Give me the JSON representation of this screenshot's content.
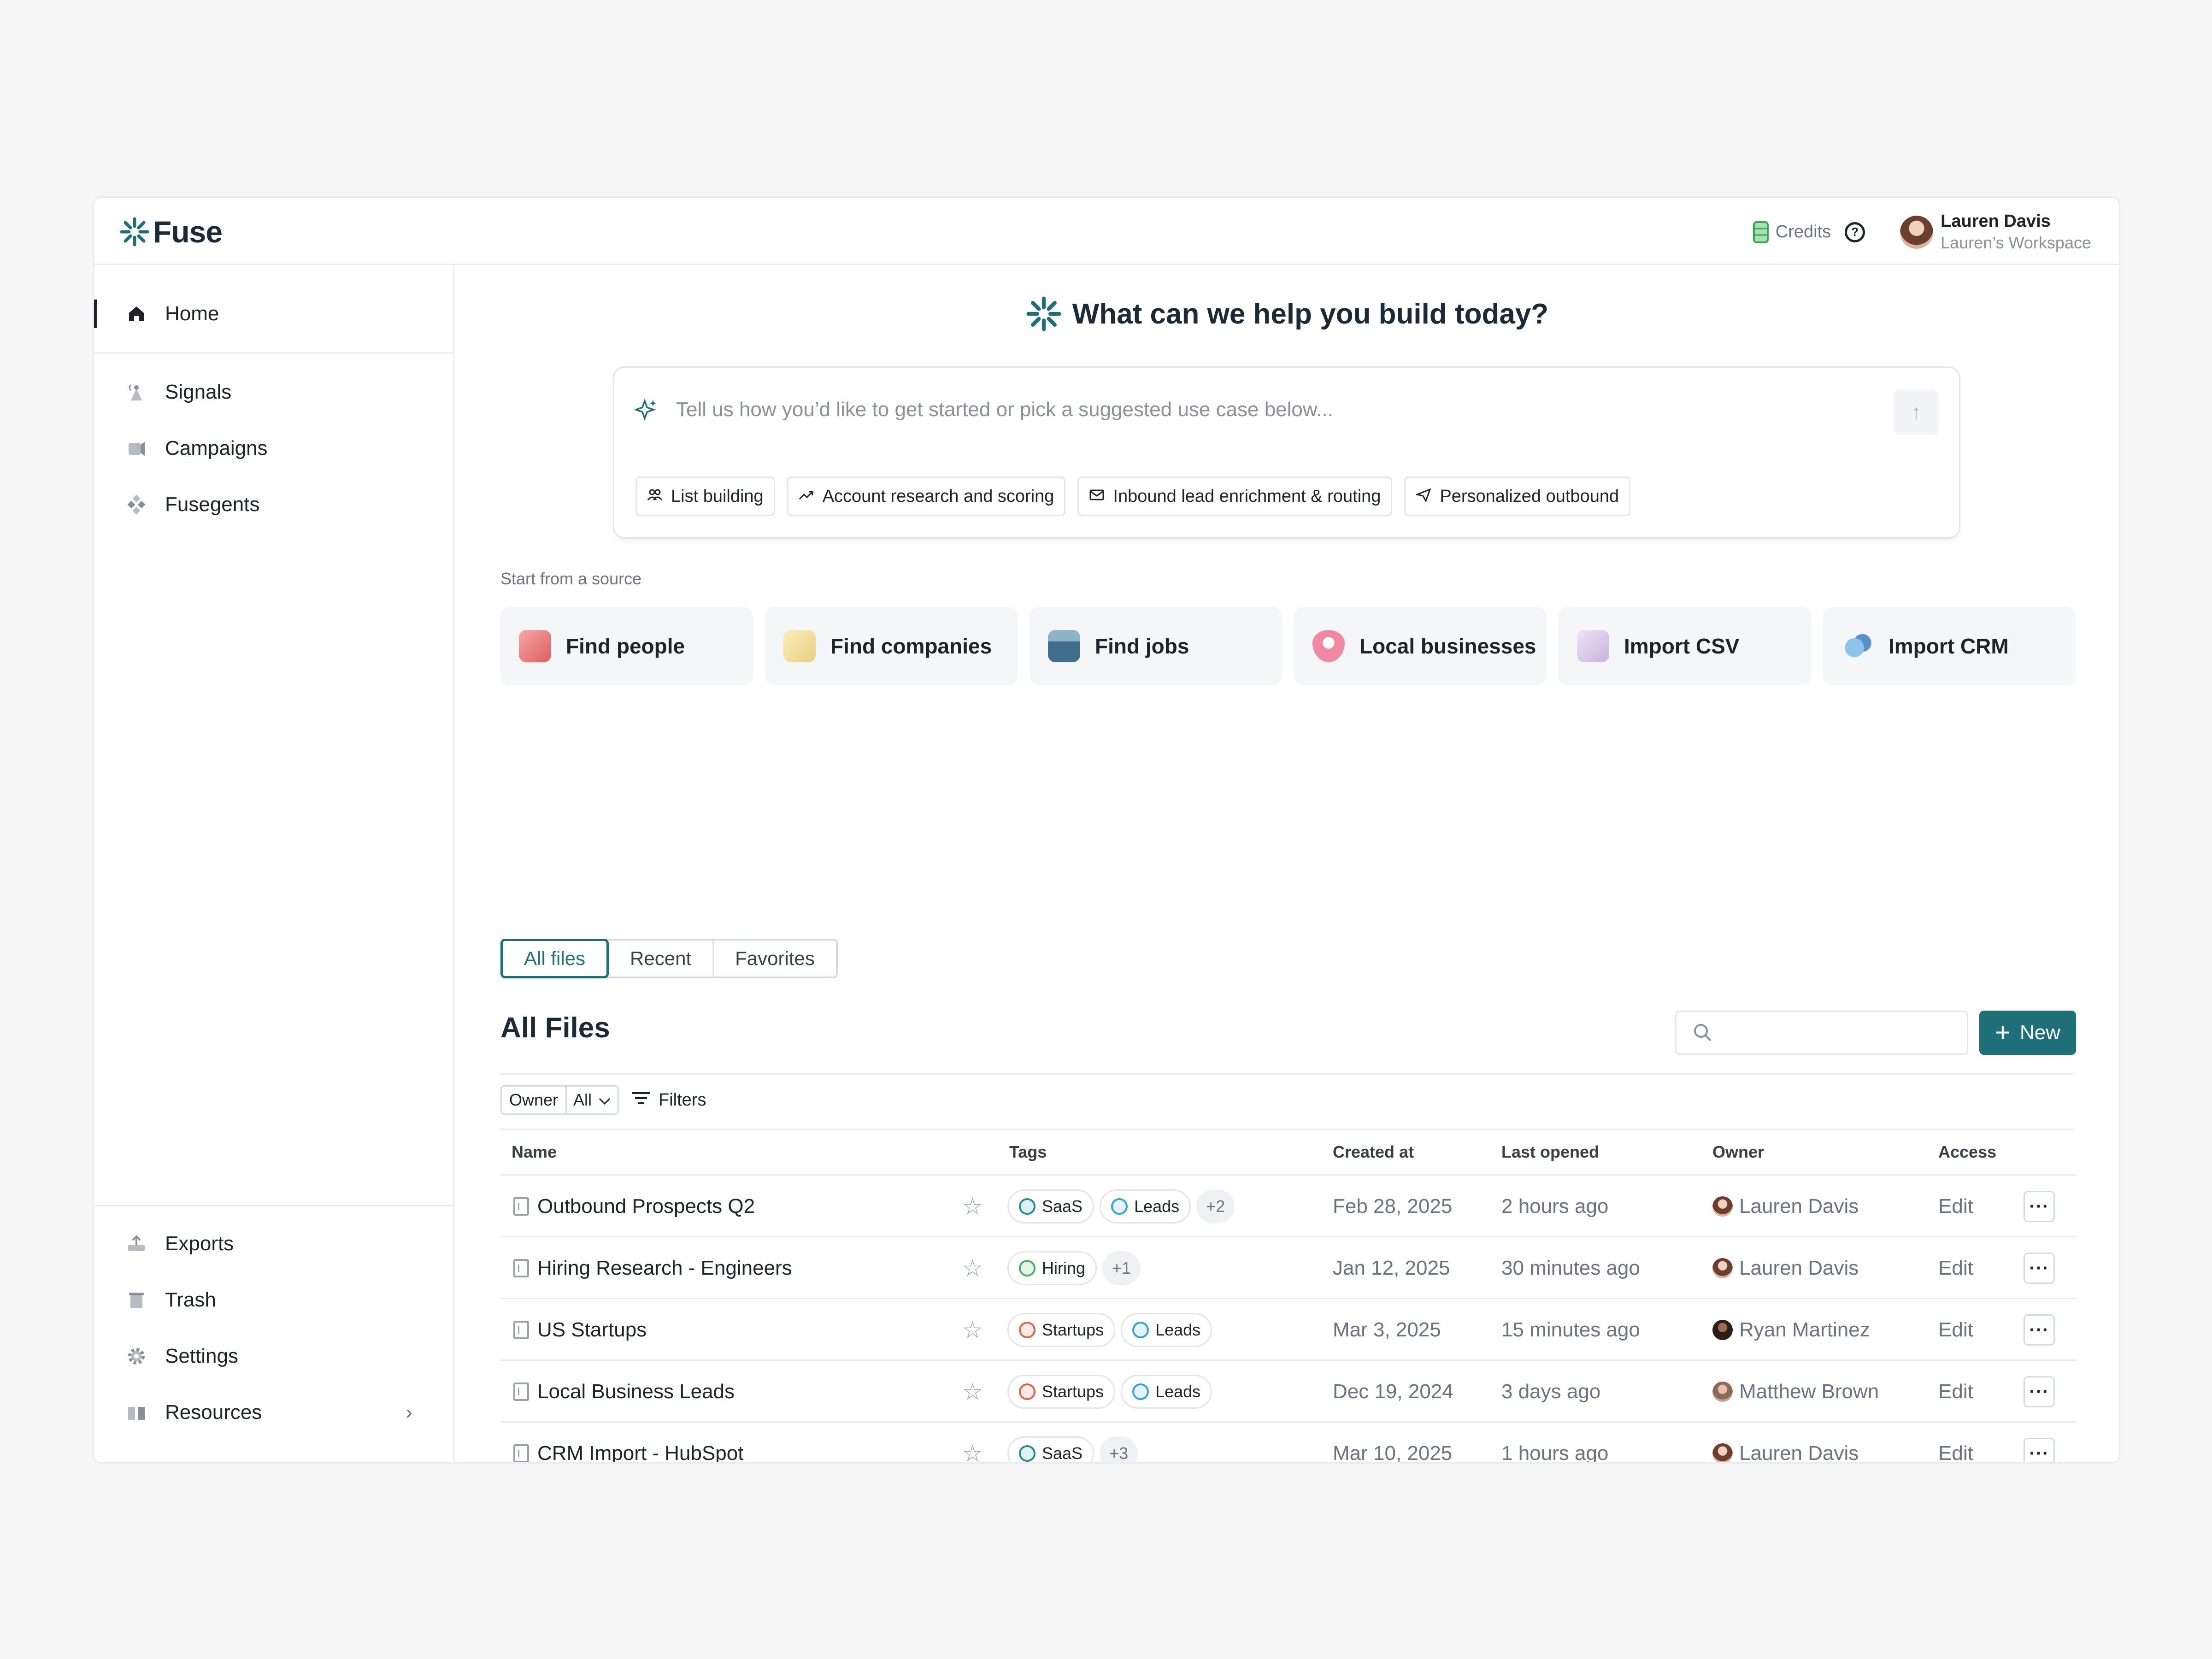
{
  "app": {
    "brand": "Fuse",
    "brand_color": "#1f6f78"
  },
  "topbar": {
    "credits_label": "Credits",
    "user": {
      "name": "Lauren Davis",
      "workspace": "Lauren’s Workspace"
    }
  },
  "sidebar": {
    "home": "Home",
    "items": [
      {
        "label": "Signals",
        "icon": "signal-tower-icon"
      },
      {
        "label": "Campaigns",
        "icon": "megaphone-icon"
      },
      {
        "label": "Fusegents",
        "icon": "fusegent-icon"
      }
    ],
    "bottom_items": [
      {
        "label": "Exports",
        "icon": "export-icon"
      },
      {
        "label": "Trash",
        "icon": "trash-icon"
      },
      {
        "label": "Settings",
        "icon": "gear-icon"
      },
      {
        "label": "Resources",
        "icon": "book-icon"
      }
    ]
  },
  "hero": {
    "title": "What can we help you build today?"
  },
  "prompt": {
    "placeholder": "Tell us how you’d like to get started or pick a suggested use case below...",
    "chips": [
      {
        "label": "List building",
        "icon": "people-icon"
      },
      {
        "label": "Account research and scoring",
        "icon": "trend-up-icon"
      },
      {
        "label": "Inbound lead enrichment & routing",
        "icon": "mail-icon"
      },
      {
        "label": "Personalized outbound",
        "icon": "send-icon"
      }
    ]
  },
  "sources": {
    "label": "Start from a source",
    "items": [
      {
        "label": "Find people",
        "icon": "find-people-icon"
      },
      {
        "label": "Find companies",
        "icon": "find-companies-icon"
      },
      {
        "label": "Find jobs",
        "icon": "briefcase-icon"
      },
      {
        "label": "Local businesses",
        "icon": "map-pin-icon"
      },
      {
        "label": "Import CSV",
        "icon": "csv-file-icon"
      },
      {
        "label": "Import CRM",
        "icon": "crm-cloud-icon"
      }
    ]
  },
  "tabs": [
    "All files",
    "Recent",
    "Favorites"
  ],
  "files": {
    "title": "All Files",
    "search_placeholder": "",
    "new_label": "New",
    "owner_label": "Owner",
    "owner_value": "All",
    "filters_label": "Filters",
    "columns": [
      "Name",
      "Tags",
      "Created at",
      "Last opened",
      "Owner",
      "Access"
    ],
    "rows": [
      {
        "name": "Outbound Prospects Q2",
        "tags": [
          "SaaS",
          "Leads",
          "+2"
        ],
        "created": "Feb 28, 2025",
        "opened": "2 hours ago",
        "owner": "Lauren Davis",
        "access": "Edit"
      },
      {
        "name": "Hiring Research - Engineers",
        "tags": [
          "Hiring",
          "+1"
        ],
        "created": "Jan 12, 2025",
        "opened": "30 minutes ago",
        "owner": "Lauren Davis",
        "access": "Edit"
      },
      {
        "name": "US Startups",
        "tags": [
          "Startups",
          "Leads"
        ],
        "created": "Mar 3, 2025",
        "opened": "15 minutes ago",
        "owner": "Ryan Martinez",
        "access": "Edit"
      },
      {
        "name": "Local Business Leads",
        "tags": [
          "Startups",
          "Leads"
        ],
        "created": "Dec 19, 2024",
        "opened": "3 days ago",
        "owner": "Matthew Brown",
        "access": "Edit"
      },
      {
        "name": "CRM Import - HubSpot",
        "tags": [
          "SaaS",
          "+3"
        ],
        "created": "Mar 10, 2025",
        "opened": "1 hours ago",
        "owner": "Lauren Davis",
        "access": "Edit"
      }
    ]
  }
}
